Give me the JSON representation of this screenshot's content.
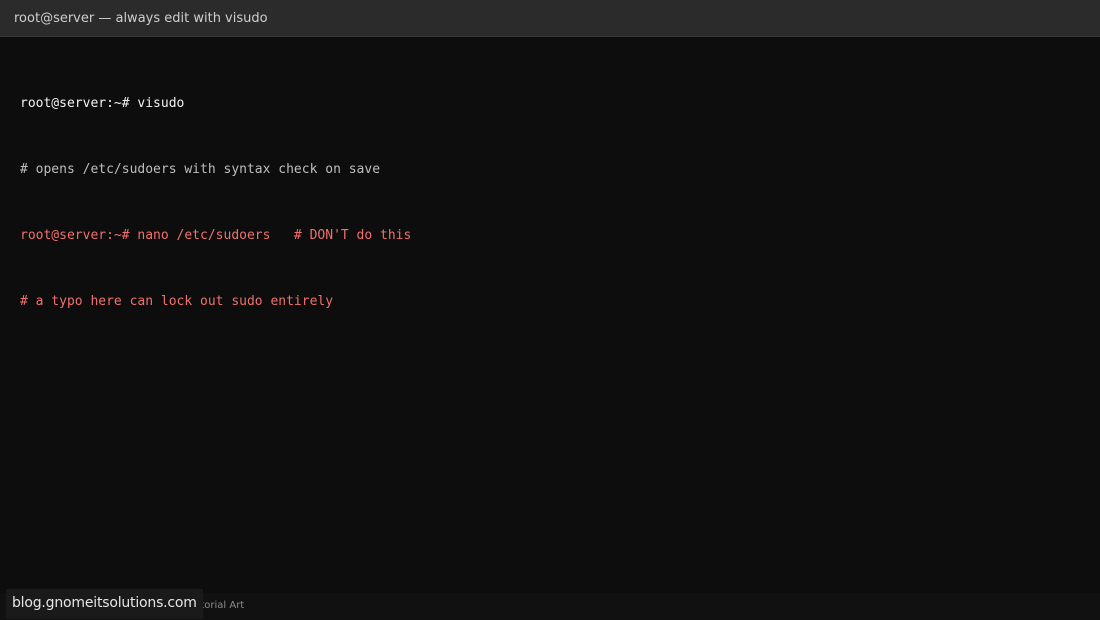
{
  "window": {
    "title": "root@server — always edit with visudo"
  },
  "terminal": {
    "lines": [
      {
        "text": "root@server:~# visudo",
        "style": "command"
      },
      {
        "text": "# opens /etc/sudoers with syntax check on save",
        "style": "comment"
      },
      {
        "text": "root@server:~# nano /etc/sudoers   # DON'T do this",
        "style": "warning"
      },
      {
        "text": "# a typo here can lock out sudo entirely",
        "style": "warning"
      }
    ]
  },
  "footer": {
    "caption": "utorial Art"
  },
  "watermark": {
    "text": "blog.gnomeitsolutions.com"
  },
  "colors": {
    "background": "#0d0d0d",
    "titlebar": "#2b2b2b",
    "command": "#f2f2f2",
    "comment": "#bdbdbd",
    "warning": "#f26f6f"
  }
}
